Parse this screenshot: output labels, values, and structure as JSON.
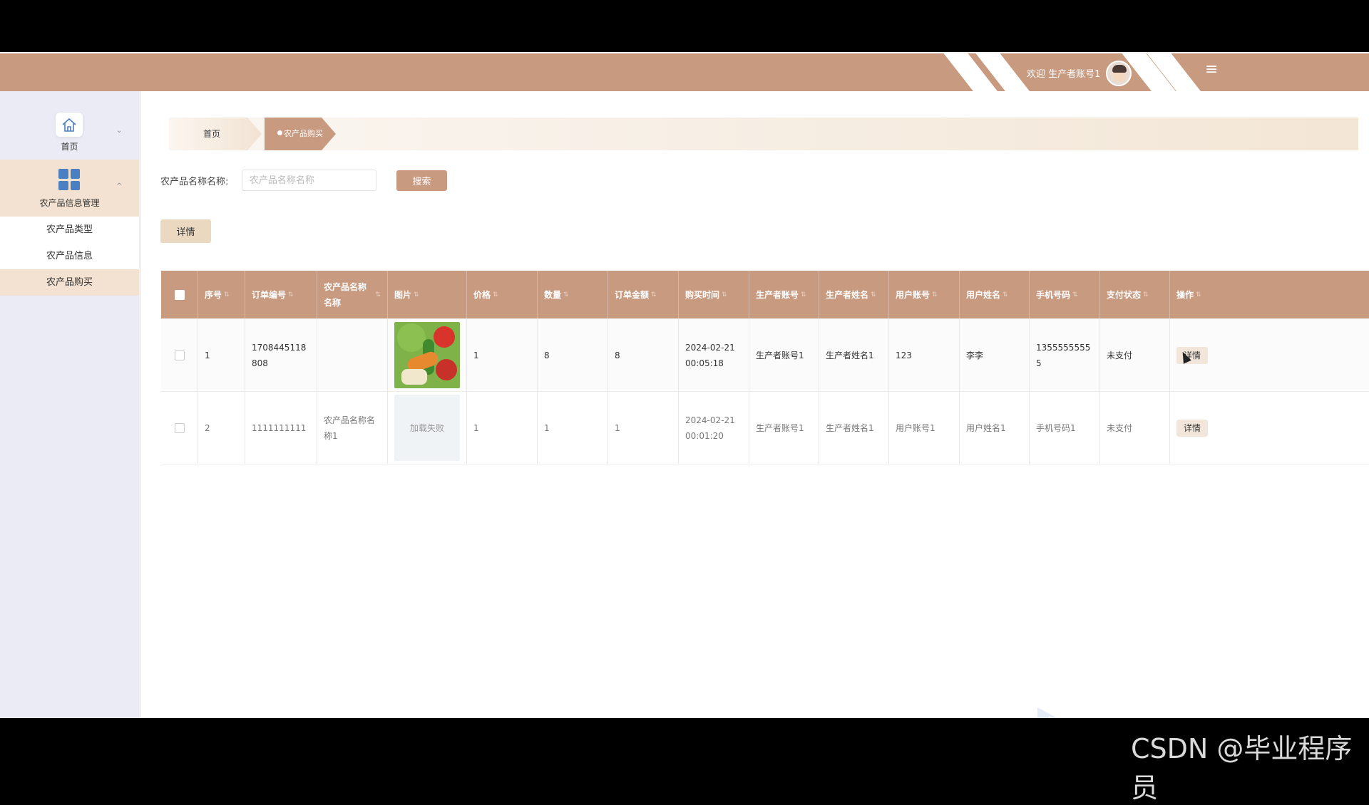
{
  "header": {
    "welcome": "欢迎 生产者账号1",
    "caret": "⌄",
    "menu_icon": "≡"
  },
  "sidebar": {
    "home_label": "首页",
    "group_label": "农产品信息管理",
    "home_arrow": "⌄",
    "group_arrow": "^",
    "items": [
      {
        "label": "农产品类型"
      },
      {
        "label": "农产品信息"
      },
      {
        "label": "农产品购买"
      }
    ]
  },
  "breadcrumb": {
    "home": "首页",
    "current": "农产品购买"
  },
  "search": {
    "label": "农产品名称名称:",
    "placeholder": "农产品名称名称",
    "button": "搜索"
  },
  "toolbar": {
    "detail_label": "详情"
  },
  "table": {
    "headers": [
      "序号",
      "订单编号",
      "农产品名称名称",
      "图片",
      "价格",
      "数量",
      "订单金额",
      "购买时间",
      "生产者账号",
      "生产者姓名",
      "用户账号",
      "用户姓名",
      "手机号码",
      "支付状态",
      "操作"
    ],
    "rows": [
      {
        "index": "1",
        "order_no": "1708445118808",
        "product_name": "",
        "image_state": "loaded",
        "price": "1",
        "quantity": "8",
        "amount": "8",
        "time": "2024-02-21 00:05:18",
        "producer_account": "生产者账号1",
        "producer_name": "生产者姓名1",
        "user_account": "123",
        "user_name": "李李",
        "phone": "13555555555",
        "pay_status": "未支付",
        "action": "详情"
      },
      {
        "index": "2",
        "order_no": "1111111111",
        "product_name": "农产品名称名称1",
        "image_state": "加载失败",
        "price": "1",
        "quantity": "1",
        "amount": "1",
        "time": "2024-02-21 00:01:20",
        "producer_account": "生产者账号1",
        "producer_name": "生产者姓名1",
        "user_account": "用户账号1",
        "user_name": "用户姓名1",
        "phone": "手机号码1",
        "pay_status": "未支付",
        "action": "详情"
      }
    ]
  },
  "colors": {
    "primary": "#c89a80",
    "accent_light": "#f3e2d2",
    "sidebar_bg": "#ebebf6",
    "detail_button": "#ead8c0"
  },
  "watermark": "CSDN @毕业程序员"
}
